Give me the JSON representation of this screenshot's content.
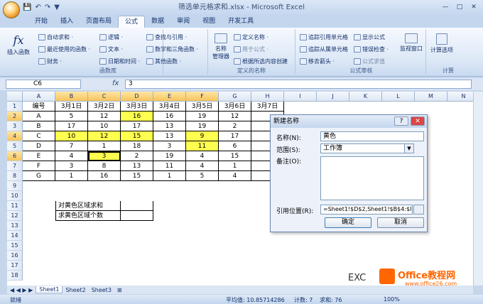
{
  "window": {
    "title": "筛选单元格求和.xlsx - Microsoft Excel",
    "controls": [
      "—",
      "□",
      "✕"
    ]
  },
  "qat": [
    "💾",
    "↶",
    "↷",
    "▼"
  ],
  "tabs": [
    "开始",
    "插入",
    "页面布局",
    "公式",
    "数据",
    "审阅",
    "视图",
    "开发工具"
  ],
  "active_tab": "公式",
  "ribbon": {
    "insert_function": "插入函数",
    "autosum": "自动求和 ·",
    "recent": "最近使用的函数 ·",
    "finance": "财务 ·",
    "logic": "逻辑 ·",
    "text": "文本 ·",
    "datetime": "日期和时间 ·",
    "lookup": "查找与引用 ·",
    "math": "数学和三角函数 ·",
    "other": "其他函数 ·",
    "group_lib": "函数库",
    "name_mgr": "名称\n管理器",
    "define_name": "定义名称 ·",
    "use_formula": "用于公式 ·",
    "create_from_sel": "根据所选内容创建",
    "group_names": "定义的名称",
    "trace_prec": "追踪引用单元格",
    "trace_dep": "追踪从属单元格",
    "remove_arrows": "移去箭头 ·",
    "show_formula": "显示公式",
    "error_check": "错误检查 ·",
    "eval_formula": "公式求值",
    "watch": "监视窗口",
    "group_audit": "公式审核",
    "calc_options": "计算选项",
    "group_calc": "计算"
  },
  "formula_bar": {
    "name_box": "C6",
    "fx": "fx",
    "value": "3"
  },
  "columns": [
    "A",
    "B",
    "C",
    "D",
    "E",
    "F",
    "G",
    "H",
    "I",
    "J",
    "K",
    "L",
    "M",
    "N"
  ],
  "rows": [
    "1",
    "2",
    "3",
    "4",
    "5",
    "6",
    "7",
    "8",
    "9",
    "10",
    "11",
    "12",
    "13",
    "14",
    "15",
    "16",
    "17",
    "18"
  ],
  "table": {
    "header": [
      "编号",
      "3月1日",
      "3月2日",
      "3月3日",
      "3月4日",
      "3月5日",
      "3月6日",
      "3月7日"
    ],
    "data": [
      [
        "A",
        "5",
        "12",
        "16",
        "16",
        "19",
        "12",
        ""
      ],
      [
        "B",
        "17",
        "10",
        "17",
        "13",
        "19",
        "2",
        ""
      ],
      [
        "C",
        "10",
        "12",
        "15",
        "13",
        "9",
        "17",
        ""
      ],
      [
        "D",
        "7",
        "1",
        "18",
        "3",
        "11",
        "6",
        ""
      ],
      [
        "E",
        "4",
        "3",
        "2",
        "19",
        "4",
        "15",
        ""
      ],
      [
        "F",
        "3",
        "8",
        "13",
        "11",
        "4",
        "1",
        ""
      ],
      [
        "G",
        "1",
        "16",
        "15",
        "1",
        "5",
        "4",
        ""
      ]
    ]
  },
  "summary": {
    "sum_label": "对黄色区域求和",
    "count_label": "求黄色区域个数"
  },
  "dialog": {
    "title": "新建名称",
    "help": "?",
    "close": "✕",
    "name_label": "名称(N):",
    "name_value": "黄色",
    "scope_label": "范围(S):",
    "scope_value": "工作簿",
    "comment_label": "备注(O):",
    "ref_label": "引用位置(R):",
    "ref_value": "=Sheet1!$D$2,Sheet1!$B$4:$I",
    "ok": "确定",
    "cancel": "取消"
  },
  "sheets": [
    "Sheet1",
    "Sheet2",
    "Sheet3"
  ],
  "sheet_nav": "◀ ◀ ▶ ▶",
  "status": {
    "mode": "就绪",
    "average": "平均值: 10.85714286",
    "count": "计数: 7",
    "sum": "求和: 76",
    "zoom": "100%"
  },
  "watermark": {
    "text1": "EXC",
    "text2": "Office教程网",
    "url": "www.office26.com"
  },
  "colors": {
    "yellow": "#ffff50",
    "ribbon": "#dbe7f6",
    "accent": "#f60"
  }
}
